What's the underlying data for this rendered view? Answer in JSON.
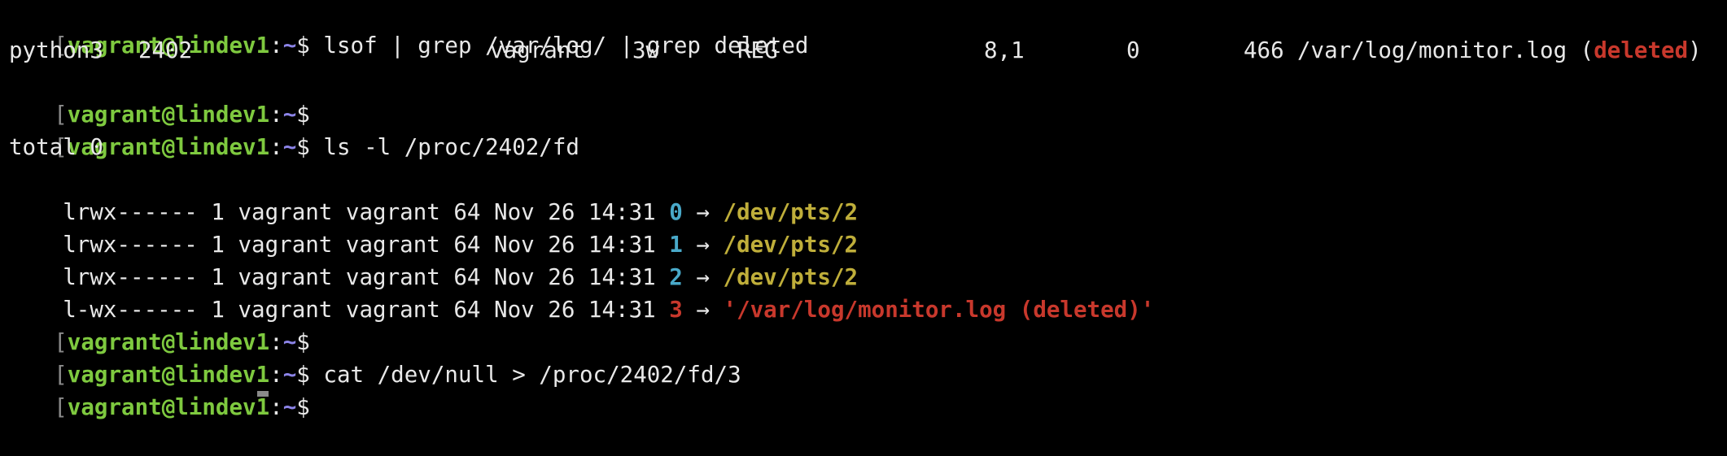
{
  "prompt": {
    "bracket": "[",
    "userhost": "vagrant@lindev1",
    "colon": ":",
    "path": "~",
    "dollar": "$"
  },
  "commands": [
    " lsof | grep /var/log/ | grep deleted",
    "",
    " ls -l /proc/2402/fd",
    "",
    " cat /dev/null > /proc/2402/fd/3",
    ""
  ],
  "lsof_row": {
    "command": "python3",
    "pid": "2402",
    "user": "vagrant",
    "fd": "3w",
    "type": "REG",
    "device": "8,1",
    "size": "0",
    "node": "466",
    "name": "/var/log/monitor.log (",
    "deleted": "deleted",
    "close": ")"
  },
  "ls_output": {
    "total": "total 0",
    "entries": [
      {
        "meta": "lrwx------ 1 vagrant vagrant 64 Nov 26 14:31 ",
        "fd": "0",
        "arrow": " → ",
        "target": "/dev/pts/2",
        "deleted": false
      },
      {
        "meta": "lrwx------ 1 vagrant vagrant 64 Nov 26 14:31 ",
        "fd": "1",
        "arrow": " → ",
        "target": "/dev/pts/2",
        "deleted": false
      },
      {
        "meta": "lrwx------ 1 vagrant vagrant 64 Nov 26 14:31 ",
        "fd": "2",
        "arrow": " → ",
        "target": "/dev/pts/2",
        "deleted": false
      },
      {
        "meta": "l-wx------ 1 vagrant vagrant 64 Nov 26 14:31 ",
        "fd": "3",
        "arrow": " → ",
        "target": "'/var/log/monitor.log (deleted)'",
        "deleted": true
      }
    ]
  },
  "colors": {
    "background": "#000000",
    "userhost": "#7ec93f",
    "path": "#8c84e8",
    "fd_number": "#49a9c9",
    "link_target": "#bfae3a",
    "deleted": "#c8382c"
  }
}
